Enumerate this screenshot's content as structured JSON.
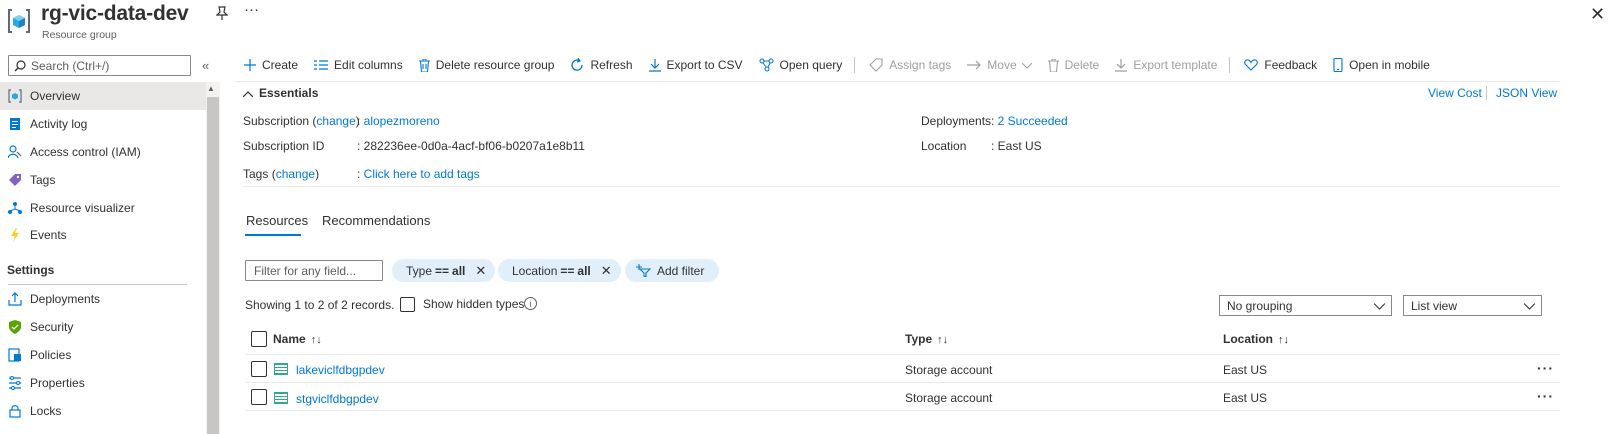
{
  "header": {
    "title": "rg-vic-data-dev",
    "subtitle": "Resource group",
    "pin_icon": "pin-icon",
    "more": "···",
    "close": "✕"
  },
  "sidebar": {
    "search_placeholder": "Search (Ctrl+/)",
    "collapse": "«",
    "items": [
      {
        "label": "Overview",
        "icon": "resource-group-icon",
        "selected": true
      },
      {
        "label": "Activity log",
        "icon": "activity-log-icon"
      },
      {
        "label": "Access control (IAM)",
        "icon": "iam-icon"
      },
      {
        "label": "Tags",
        "icon": "tag-icon"
      },
      {
        "label": "Resource visualizer",
        "icon": "visualizer-icon"
      },
      {
        "label": "Events",
        "icon": "lightning-icon"
      }
    ],
    "settings_heading": "Settings",
    "settings_items": [
      {
        "label": "Deployments",
        "icon": "deploy-icon"
      },
      {
        "label": "Security",
        "icon": "shield-icon"
      },
      {
        "label": "Policies",
        "icon": "policy-icon"
      },
      {
        "label": "Properties",
        "icon": "properties-icon"
      },
      {
        "label": "Locks",
        "icon": "lock-icon"
      }
    ]
  },
  "toolbar": {
    "create": "Create",
    "edit_columns": "Edit columns",
    "delete_rg": "Delete resource group",
    "refresh": "Refresh",
    "export_csv": "Export to CSV",
    "open_query": "Open query",
    "assign_tags": "Assign tags",
    "move": "Move",
    "delete": "Delete",
    "export_template": "Export template",
    "feedback": "Feedback",
    "open_mobile": "Open in mobile"
  },
  "essentials": {
    "heading": "Essentials",
    "view_cost": "View Cost",
    "json_view": "JSON View",
    "subscription_label": "Subscription",
    "change": "change",
    "subscription_value": "alopezmoreno",
    "subscription_id_label": "Subscription ID",
    "subscription_id_value": "282236ee-0d0a-4acf-bf06-b0207a1e8b11",
    "tags_label": "Tags",
    "tags_value": "Click here to add tags",
    "deployments_label": "Deployments",
    "deployments_value": "2 Succeeded",
    "location_label": "Location",
    "location_value": "East US"
  },
  "tabs": {
    "resources": "Resources",
    "recommendations": "Recommendations"
  },
  "filters": {
    "placeholder": "Filter for any field...",
    "type_key": "Type",
    "type_op": "==",
    "type_val": "all",
    "location_key": "Location",
    "location_op": "==",
    "location_val": "all",
    "add_filter": "Add filter"
  },
  "records": {
    "showing": "Showing 1 to 2 of 2 records.",
    "show_hidden": "Show hidden types",
    "grouping": "No grouping",
    "view": "List view"
  },
  "table": {
    "headers": {
      "name": "Name",
      "name_sort": "↑↓",
      "type": "Type",
      "type_sort": "↑↓",
      "location": "Location",
      "location_sort": "↑↓"
    },
    "rows": [
      {
        "name": "lakeviclfdbgpdev",
        "type": "Storage account",
        "location": "East US",
        "more": "···"
      },
      {
        "name": "stgviclfdbgpdev",
        "type": "Storage account",
        "location": "East US",
        "more": "···"
      }
    ]
  },
  "colors": {
    "accent": "#0078d4",
    "selected_bg": "#e9e8e7",
    "pill_bg": "#e1effa"
  }
}
